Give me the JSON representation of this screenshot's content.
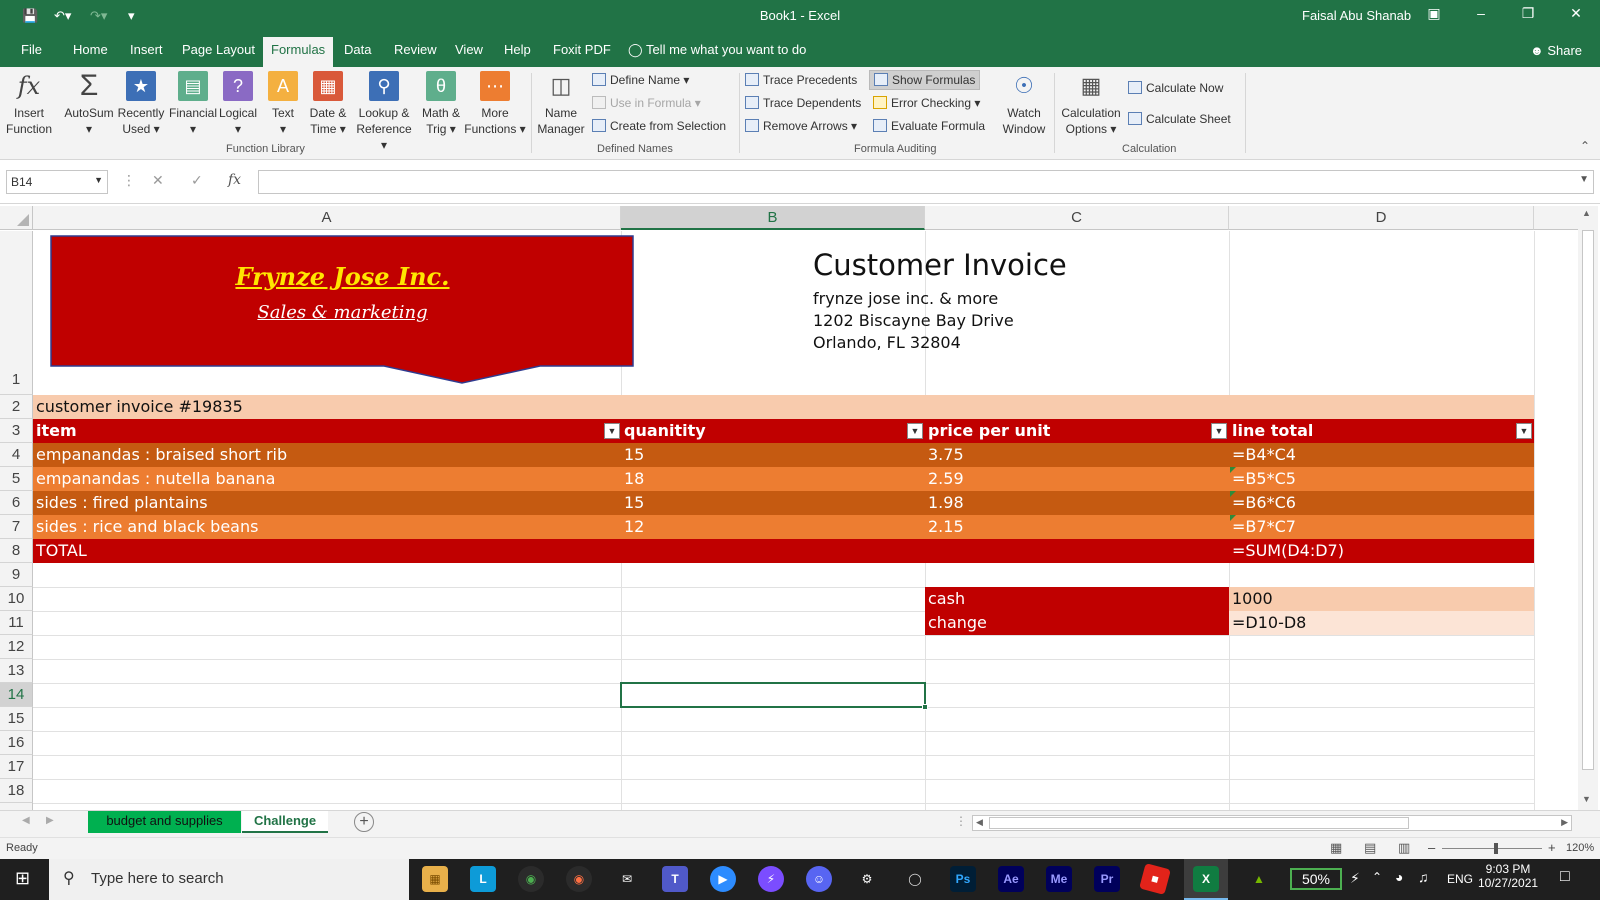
{
  "window": {
    "title": "Book1  -  Excel",
    "user": "Faisal Abu Shanab"
  },
  "tabs": [
    "File",
    "Home",
    "Insert",
    "Page Layout",
    "Formulas",
    "Data",
    "Review",
    "View",
    "Help",
    "Foxit PDF"
  ],
  "active_tab": "Formulas",
  "tell_me": "Tell me what you want to do",
  "share": "Share",
  "ribbon": {
    "function_library": {
      "label": "Function Library",
      "insert_function": [
        "Insert",
        "Function"
      ],
      "autosum": "AutoSum",
      "recently_used": [
        "Recently",
        "Used"
      ],
      "financial": "Financial",
      "logical": "Logical",
      "text": "Text",
      "date_time": [
        "Date &",
        "Time"
      ],
      "lookup_reference": [
        "Lookup &",
        "Reference"
      ],
      "math_trig": [
        "Math &",
        "Trig"
      ],
      "more_functions": [
        "More",
        "Functions"
      ]
    },
    "defined_names": {
      "label": "Defined Names",
      "name_manager": [
        "Name",
        "Manager"
      ],
      "define_name": "Define Name",
      "use_in_formula": "Use in Formula",
      "create_from_selection": "Create from Selection"
    },
    "formula_auditing": {
      "label": "Formula Auditing",
      "trace_precedents": "Trace Precedents",
      "trace_dependents": "Trace Dependents",
      "remove_arrows": "Remove Arrows",
      "show_formulas": "Show Formulas",
      "error_checking": "Error Checking",
      "evaluate_formula": "Evaluate Formula",
      "watch_window": [
        "Watch",
        "Window"
      ]
    },
    "calculation": {
      "label": "Calculation",
      "calculation_options": [
        "Calculation",
        "Options"
      ],
      "calculate_now": "Calculate Now",
      "calculate_sheet": "Calculate Sheet"
    }
  },
  "formula_bar": {
    "name_box": "B14",
    "fx": "fx",
    "value": ""
  },
  "columns": [
    "A",
    "B",
    "C",
    "D"
  ],
  "selected_column": "B",
  "rows": [
    "1",
    "2",
    "3",
    "4",
    "5",
    "6",
    "7",
    "8",
    "9",
    "10",
    "11",
    "12",
    "13",
    "14",
    "15",
    "16",
    "17",
    "18"
  ],
  "selected_row": "14",
  "banner": {
    "company": "Frynze Jose Inc.",
    "tagline": "Sales & marketing"
  },
  "invoice_header": {
    "title": "Customer Invoice",
    "line1": "frynze jose inc. & more",
    "line2": "1202 Biscayne Bay Drive",
    "line3": "Orlando, FL 32804"
  },
  "invoice_number": "customer invoice #19835",
  "table": {
    "headers": [
      "item",
      "quanitity",
      "price per unit",
      "line total"
    ],
    "rows": [
      [
        "empanandas : braised short rib",
        "15",
        "3.75",
        "=B4*C4"
      ],
      [
        "empanandas : nutella banana",
        "18",
        "2.59",
        "=B5*C5"
      ],
      [
        "sides : fired plantains",
        "15",
        "1.98",
        "=B6*C6"
      ],
      [
        "sides : rice and black beans",
        "12",
        "2.15",
        "=B7*C7"
      ]
    ],
    "total_label": "TOTAL",
    "total_formula": "=SUM(D4:D7)"
  },
  "payment": {
    "cash_label": "cash",
    "cash_value": "1000",
    "change_label": "change",
    "change_value": "=D10-D8"
  },
  "sheets": [
    "budget and supplies",
    "Challenge"
  ],
  "active_sheet": "Challenge",
  "status": {
    "ready": "Ready",
    "zoom": "120%"
  },
  "taskbar": {
    "search_placeholder": "Type here to search",
    "battery": "50%",
    "language": "ENG",
    "time": "9:03 PM",
    "date": "10/27/2021",
    "apps": [
      "Ps",
      "Ae",
      "Me",
      "Pr"
    ]
  },
  "colors": {
    "excel_green": "#217346",
    "banner_red": "#c00000",
    "row_dark_orange": "#c55a11",
    "row_orange": "#ed7d31",
    "peach": "#f8cbad",
    "light_peach": "#fce4d6"
  }
}
